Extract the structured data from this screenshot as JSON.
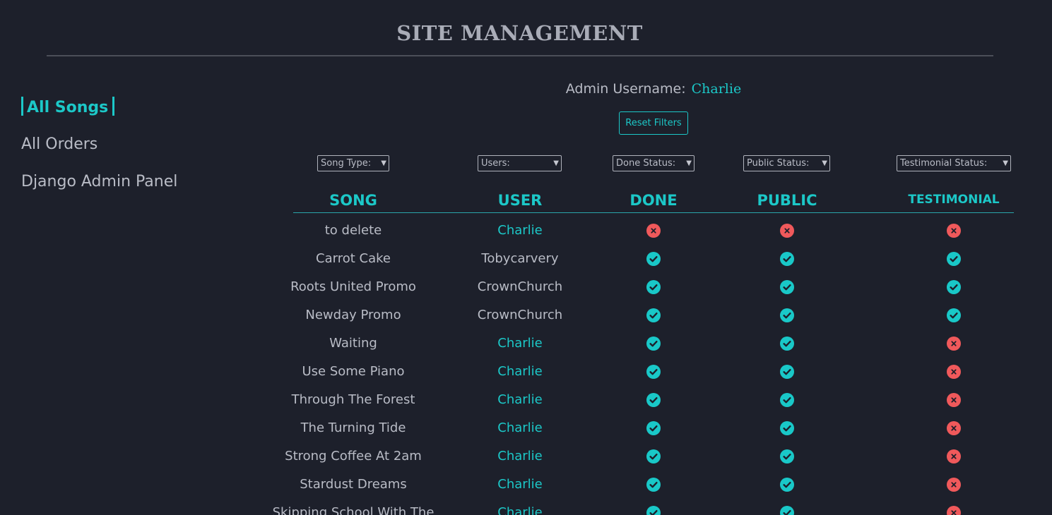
{
  "header": {
    "title": "SITE MANAGEMENT"
  },
  "sidebar": {
    "items": [
      {
        "label": "All Songs",
        "active": true
      },
      {
        "label": "All Orders",
        "active": false
      },
      {
        "label": "Django Admin Panel",
        "active": false
      }
    ]
  },
  "admin": {
    "label": "Admin Username:",
    "name": "Charlie"
  },
  "reset_button": {
    "label": "Reset Filters"
  },
  "filters": {
    "song_type": "Song Type:",
    "users": "Users:",
    "done_status": "Done Status:",
    "public_status": "Public Status:",
    "testimonial_status": "Testimonial Status:"
  },
  "table": {
    "columns": [
      "SONG",
      "USER",
      "DONE",
      "PUBLIC",
      "TESTIMONIAL"
    ],
    "rows": [
      {
        "song": "to delete",
        "user": "Charlie",
        "done": false,
        "public": false,
        "testimonial": false
      },
      {
        "song": "Carrot Cake",
        "user": "Tobycarvery",
        "done": true,
        "public": true,
        "testimonial": true
      },
      {
        "song": "Roots United Promo",
        "user": "CrownChurch",
        "done": true,
        "public": true,
        "testimonial": true
      },
      {
        "song": "Newday Promo",
        "user": "CrownChurch",
        "done": true,
        "public": true,
        "testimonial": true
      },
      {
        "song": "Waiting",
        "user": "Charlie",
        "done": true,
        "public": true,
        "testimonial": false
      },
      {
        "song": "Use Some Piano",
        "user": "Charlie",
        "done": true,
        "public": true,
        "testimonial": false
      },
      {
        "song": "Through The Forest",
        "user": "Charlie",
        "done": true,
        "public": true,
        "testimonial": false
      },
      {
        "song": "The Turning Tide",
        "user": "Charlie",
        "done": true,
        "public": true,
        "testimonial": false
      },
      {
        "song": "Strong Coffee At 2am",
        "user": "Charlie",
        "done": true,
        "public": true,
        "testimonial": false
      },
      {
        "song": "Stardust Dreams",
        "user": "Charlie",
        "done": true,
        "public": true,
        "testimonial": false
      },
      {
        "song": "Skipping School With The",
        "user": "Charlie",
        "done": true,
        "public": true,
        "testimonial": false
      }
    ]
  },
  "icons": {
    "yes": "check-circle-icon",
    "no": "x-circle-icon"
  },
  "colors": {
    "background": "#1d202b",
    "accent": "#1cc8c8",
    "text": "#b9bcc6",
    "yes": "#19c8c8",
    "no": "#f0595b"
  }
}
